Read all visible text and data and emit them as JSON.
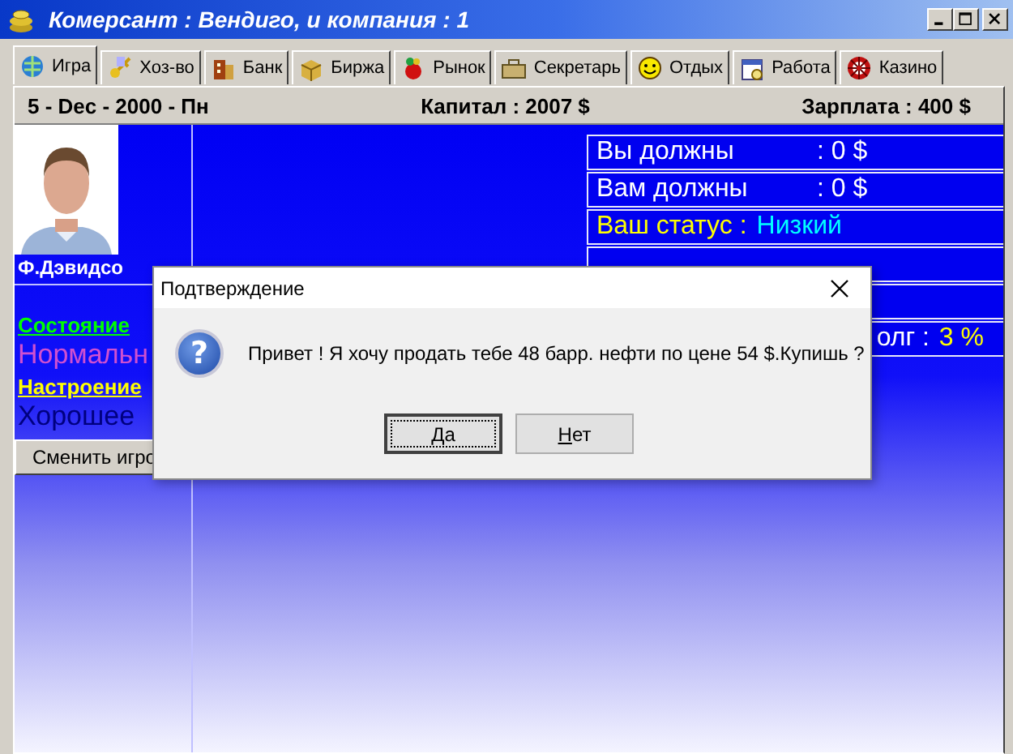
{
  "window": {
    "title": "Комерсант : Вендиго, и компания : 1"
  },
  "tabs": [
    {
      "label": "Игра",
      "kind": "globe",
      "selected": true
    },
    {
      "label": "Хоз-во",
      "kind": "key",
      "selected": false
    },
    {
      "label": "Банк",
      "kind": "building",
      "selected": false
    },
    {
      "label": "Биржа",
      "kind": "box",
      "selected": false
    },
    {
      "label": "Рынок",
      "kind": "bag",
      "selected": false
    },
    {
      "label": "Секретарь",
      "kind": "case",
      "selected": false
    },
    {
      "label": "Отдых",
      "kind": "smiley",
      "selected": false
    },
    {
      "label": "Работа",
      "kind": "calendar",
      "selected": false
    },
    {
      "label": "Казино",
      "kind": "wheel",
      "selected": false
    }
  ],
  "info_bar": {
    "date": "5 - Dec - 2000  - Пн",
    "capital": "Капитал : 2007 $",
    "salary": "Зарплата : 400 $"
  },
  "player": {
    "name": "Ф.Дэвидсо",
    "condition_label": "Состояние",
    "condition": "Нормальн",
    "mood_label": "Настроение",
    "mood": "Хорошее",
    "button": "Сменить игро"
  },
  "stats": [
    {
      "kind": "plain",
      "label": "Вы должны",
      "value": ": 0 $"
    },
    {
      "kind": "plain",
      "label": "Вам должны",
      "value": ": 0 $"
    },
    {
      "kind": "status",
      "label": "Ваш статус :",
      "value": "Низкий"
    },
    {
      "kind": "empty"
    },
    {
      "kind": "empty"
    },
    {
      "kind": "debt",
      "label": "олг :",
      "value": "3 %"
    }
  ],
  "dialog": {
    "title": "Подтверждение",
    "icon_glyph": "?",
    "message": "Привет ! Я хочу продать тебе 48 барр. нефти по цене 54 $.Купишь ?",
    "buttons": [
      {
        "label": "Да",
        "default": true
      },
      {
        "label": "Нет",
        "default": false
      }
    ]
  }
}
